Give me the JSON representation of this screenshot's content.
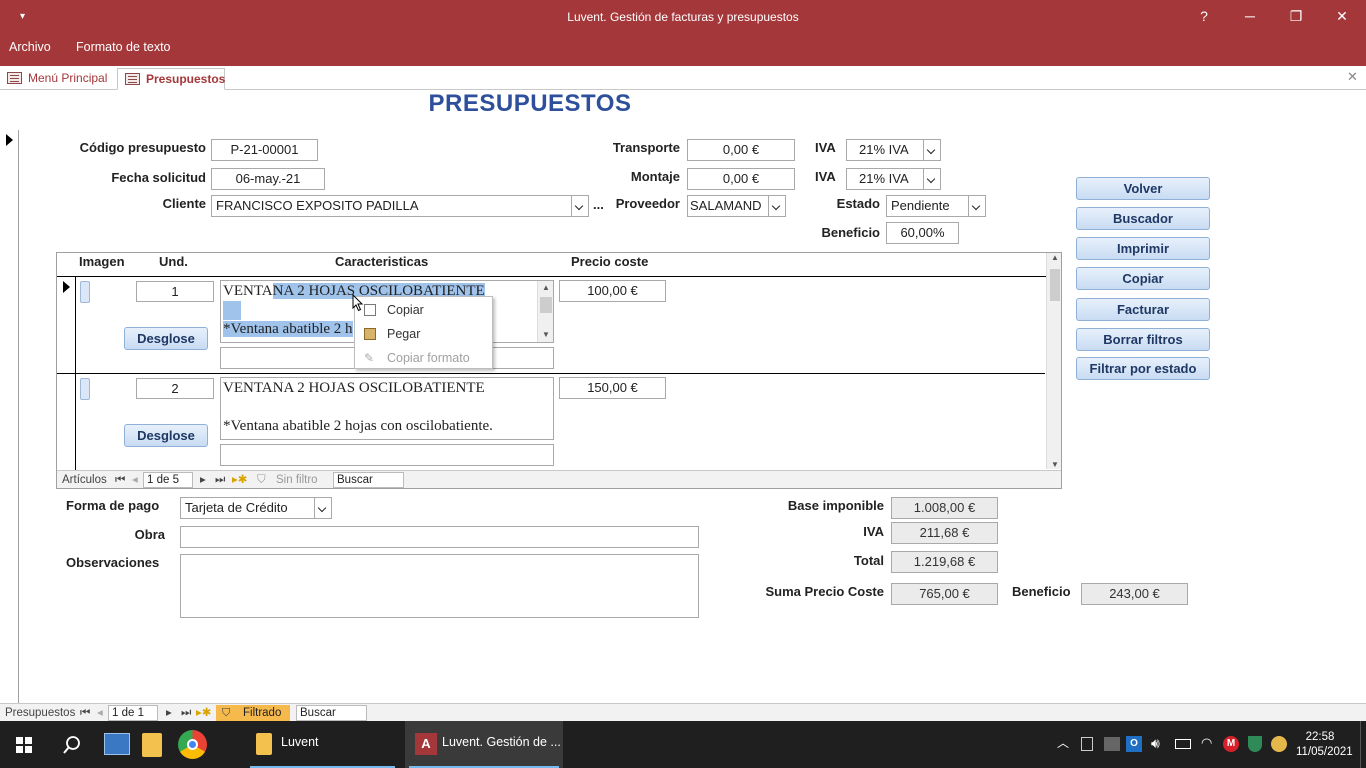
{
  "window": {
    "title": "Luvent. Gestión de facturas y presupuestos",
    "help": "?",
    "minimize": "─",
    "restore": "❐",
    "close": "✕",
    "qat": "▾"
  },
  "ribbon": {
    "tabs": [
      "Archivo",
      "Formato de texto"
    ]
  },
  "doc_tabs": {
    "menu": "Menú Principal",
    "presupuestos": "Presupuestos",
    "close": "✕"
  },
  "form": {
    "title": "PRESUPUESTOS",
    "codigo_label": "Código presupuesto",
    "codigo_value": "P-21-00001",
    "fecha_label": "Fecha solicitud",
    "fecha_value": "06-may.-21",
    "cliente_label": "Cliente",
    "cliente_value": "FRANCISCO EXPOSITO PADILLA",
    "cliente_more": "...",
    "transporte_label": "Transporte",
    "transporte_value": "0,00 €",
    "montaje_label": "Montaje",
    "montaje_value": "0,00 €",
    "proveedor_label": "Proveedor",
    "proveedor_value": "SALAMAND",
    "iva1_label": "IVA",
    "iva1_value": "21% IVA",
    "iva2_label": "IVA",
    "iva2_value": "21% IVA",
    "estado_label": "Estado",
    "estado_value": "Pendiente",
    "beneficio_label": "Beneficio",
    "beneficio_value": "60,00%"
  },
  "buttons": [
    "Volver",
    "Buscador",
    "Imprimir",
    "Copiar",
    "Facturar",
    "Borrar filtros",
    "Filtrar por estado"
  ],
  "subform": {
    "headers": {
      "imagen": "Imagen",
      "und": "Und.",
      "caracteristicas": "Caracteristicas",
      "precio": "Precio coste"
    },
    "rows": [
      {
        "und": "1",
        "line1_plain": "VENTA",
        "line1_selected": "NA 2 HOJAS OSCILOBATIENTE",
        "line3_selected": "*Ventana abatible 2 h",
        "precio": "100,00 €",
        "desglose": "Desglose"
      },
      {
        "und": "2",
        "line1": "VENTANA 2 HOJAS OSCILOBATIENTE",
        "line3": "*Ventana abatible 2 hojas con oscilobatiente.",
        "precio": "150,00 €",
        "desglose": "Desglose"
      }
    ],
    "nav": {
      "label": "Artículos",
      "record": "1 de 5",
      "filter": "Sin filtro",
      "search": "Buscar"
    }
  },
  "context_menu": {
    "items": [
      "Copiar",
      "Pegar",
      "Copiar formato"
    ]
  },
  "footer": {
    "pago_label": "Forma de pago",
    "pago_value": "Tarjeta de Crédito",
    "obra_label": "Obra",
    "obra_value": "",
    "obs_label": "Observaciones",
    "obs_value": "",
    "base_label": "Base imponible",
    "base_value": "1.008,00 €",
    "iva_label": "IVA",
    "iva_value": "211,68 €",
    "total_label": "Total",
    "total_value": "1.219,68 €",
    "suma_label": "Suma Precio Coste",
    "suma_value": "765,00 €",
    "benef_label": "Beneficio",
    "benef_value": "243,00 €"
  },
  "main_nav": {
    "label": "Presupuestos",
    "record": "1 de 1",
    "filter": "Filtrado",
    "search": "Buscar"
  },
  "taskbar": {
    "apps": [
      "Luvent",
      "Luvent. Gestión de ..."
    ],
    "time": "22:58",
    "date": "11/05/2021"
  },
  "colors": {
    "titlebar": "#a4373a",
    "form_title": "#2e4f9b",
    "button": "#c9dcf3",
    "taskbar": "#1f1f1f"
  }
}
